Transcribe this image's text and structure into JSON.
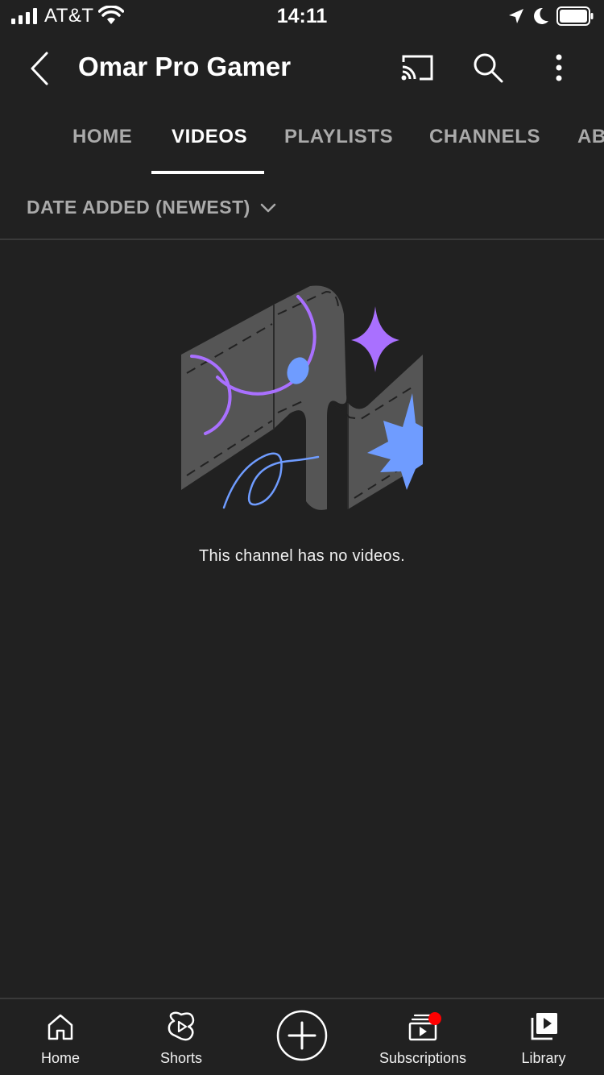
{
  "status_bar": {
    "carrier": "AT&T",
    "time": "14:11"
  },
  "header": {
    "title": "Omar Pro Gamer"
  },
  "tabs": [
    {
      "label": "HOME",
      "active": false
    },
    {
      "label": "VIDEOS",
      "active": true
    },
    {
      "label": "PLAYLISTS",
      "active": false
    },
    {
      "label": "CHANNELS",
      "active": false
    },
    {
      "label": "AB",
      "active": false
    }
  ],
  "sort": {
    "label": "DATE ADDED (NEWEST)"
  },
  "empty_state": {
    "message": "This channel has no videos."
  },
  "bottom_nav": [
    {
      "label": "Home",
      "icon": "home-icon"
    },
    {
      "label": "Shorts",
      "icon": "shorts-icon"
    },
    {
      "label": "",
      "icon": "create-icon"
    },
    {
      "label": "Subscriptions",
      "icon": "subscriptions-icon"
    },
    {
      "label": "Library",
      "icon": "library-icon"
    }
  ],
  "colors": {
    "background": "#212121",
    "text_primary": "#ffffff",
    "text_secondary": "#aaaaaa",
    "illustration_purple": "#a970ff",
    "illustration_blue": "#6f9cff",
    "notification_red": "#ff0000"
  }
}
